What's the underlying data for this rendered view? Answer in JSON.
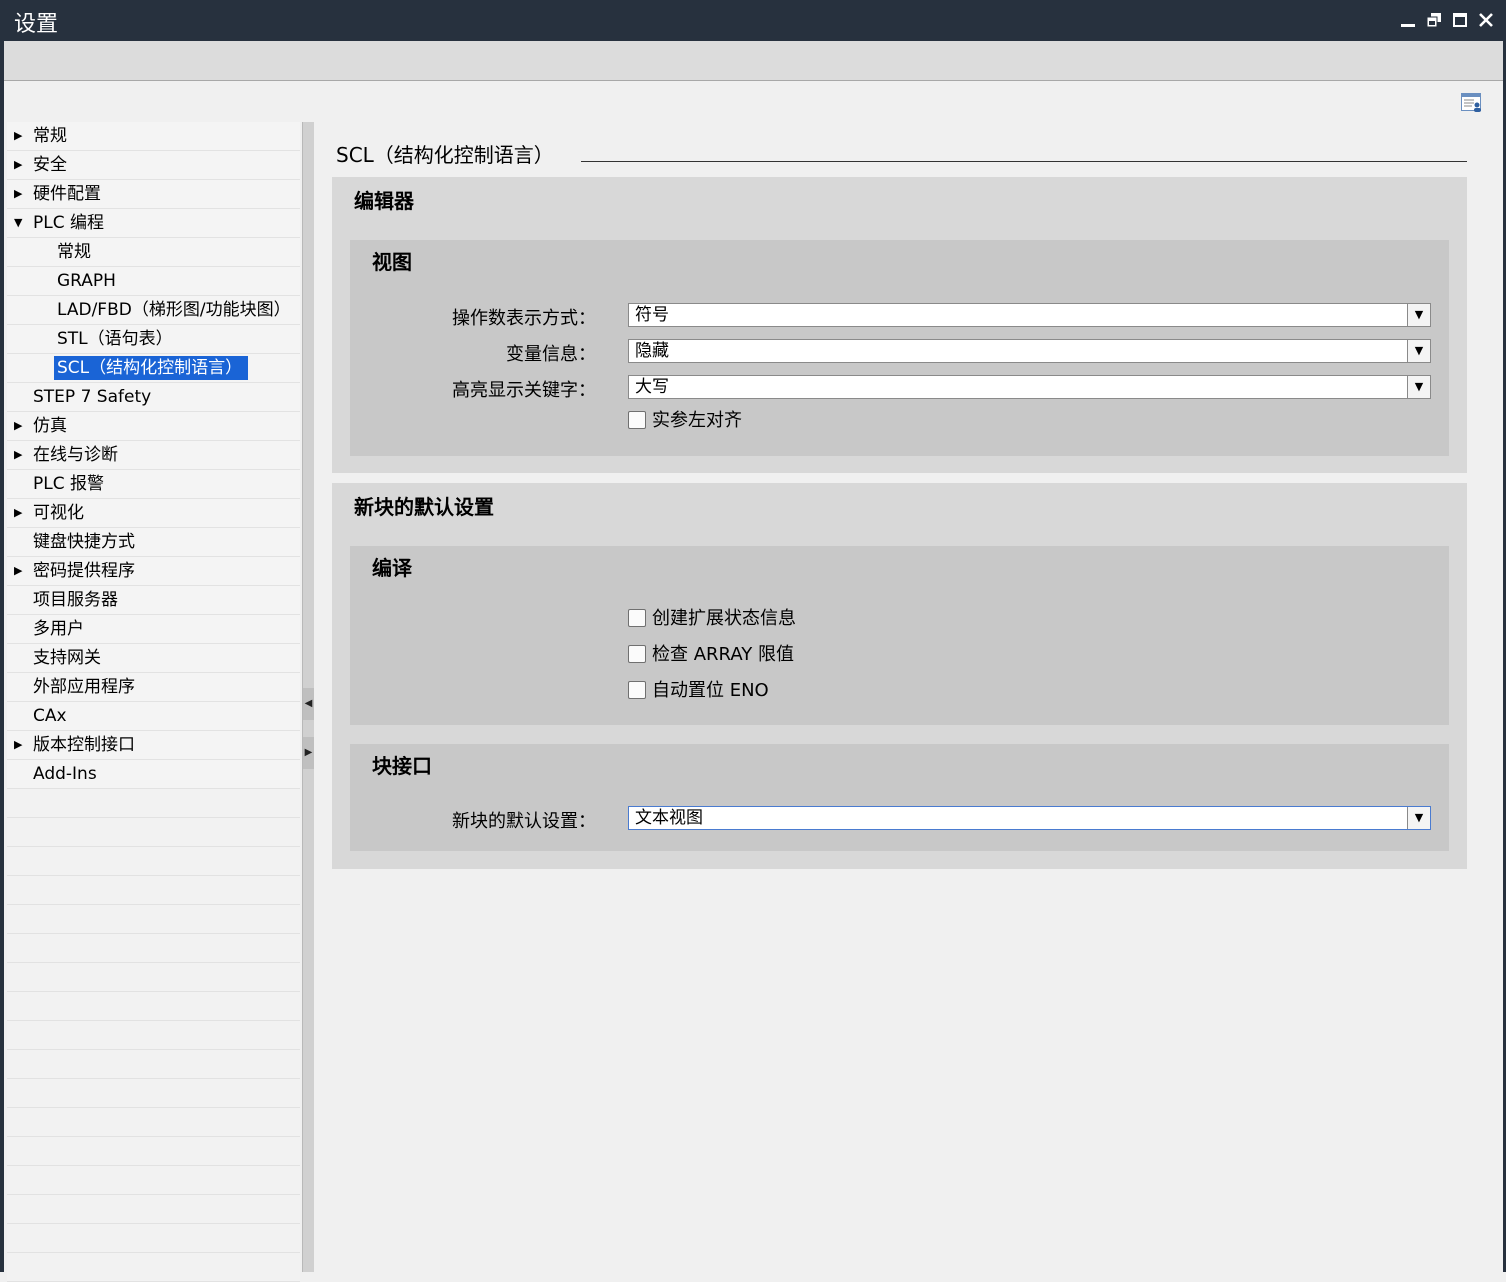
{
  "window": {
    "title": "设置",
    "controls": [
      "minimize-icon",
      "restore-icon",
      "maximize-icon",
      "close-icon"
    ]
  },
  "nav": {
    "items": [
      {
        "label": "常规",
        "expander": "right",
        "level": 0
      },
      {
        "label": "安全",
        "expander": "right",
        "level": 0
      },
      {
        "label": "硬件配置",
        "expander": "right",
        "level": 0
      },
      {
        "label": "PLC 编程",
        "expander": "down",
        "level": 0
      },
      {
        "label": "常规",
        "expander": "",
        "level": 1
      },
      {
        "label": "GRAPH",
        "expander": "",
        "level": 1
      },
      {
        "label": "LAD/FBD（梯形图/功能块图）",
        "expander": "",
        "level": 1
      },
      {
        "label": "STL（语句表）",
        "expander": "",
        "level": 1
      },
      {
        "label": "SCL（结构化控制语言）",
        "expander": "",
        "level": 1,
        "selected": true
      },
      {
        "label": "STEP 7 Safety",
        "expander": "",
        "level": 0
      },
      {
        "label": "仿真",
        "expander": "right",
        "level": 0
      },
      {
        "label": "在线与诊断",
        "expander": "right",
        "level": 0
      },
      {
        "label": "PLC 报警",
        "expander": "",
        "level": 0
      },
      {
        "label": "可视化",
        "expander": "right",
        "level": 0
      },
      {
        "label": "键盘快捷方式",
        "expander": "",
        "level": 0
      },
      {
        "label": "密码提供程序",
        "expander": "right",
        "level": 0
      },
      {
        "label": "项目服务器",
        "expander": "",
        "level": 0
      },
      {
        "label": "多用户",
        "expander": "",
        "level": 0
      },
      {
        "label": "支持网关",
        "expander": "",
        "level": 0
      },
      {
        "label": "外部应用程序",
        "expander": "",
        "level": 0
      },
      {
        "label": "CAx",
        "expander": "",
        "level": 0
      },
      {
        "label": "版本控制接口",
        "expander": "right",
        "level": 0
      },
      {
        "label": "Add-Ins",
        "expander": "",
        "level": 0
      }
    ]
  },
  "main": {
    "page_title": "SCL（结构化控制语言）",
    "editor": {
      "title": "编辑器",
      "view": {
        "title": "视图",
        "operand_label": "操作数表示方式：",
        "operand_value": "符号",
        "tag_info_label": "变量信息：",
        "tag_info_value": "隐藏",
        "highlight_label": "高亮显示关键字：",
        "highlight_value": "大写",
        "align_params_label": "实参左对齐"
      }
    },
    "new_block_defaults": {
      "title": "新块的默认设置",
      "compile": {
        "title": "编译",
        "ext_status_label": "创建扩展状态信息",
        "check_array_label": "检查 ARRAY 限值",
        "auto_eno_label": "自动置位 ENO"
      },
      "block_interface": {
        "title": "块接口",
        "default_label": "新块的默认设置：",
        "default_value": "文本视图"
      }
    }
  }
}
